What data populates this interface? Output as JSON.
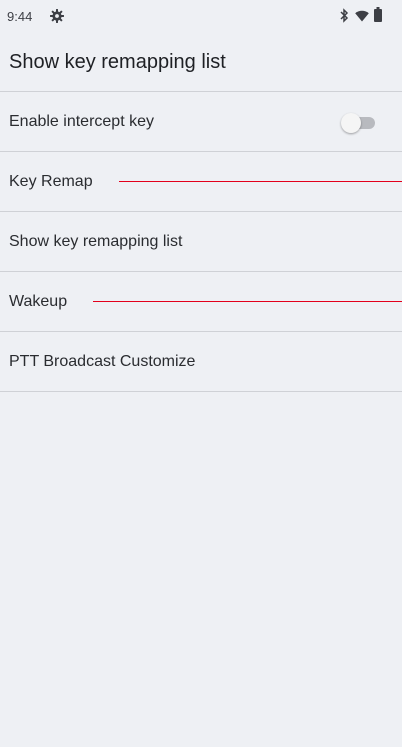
{
  "status_bar": {
    "time": "9:44",
    "icons": [
      "gear-icon",
      "bluetooth-icon",
      "wifi-icon",
      "battery-icon"
    ]
  },
  "app_bar": {
    "title": "Show key remapping list"
  },
  "settings": {
    "items": [
      {
        "label": "Enable intercept key",
        "toggle": {
          "on": false
        }
      },
      {
        "label": "Key Remap"
      },
      {
        "label": "Show key remapping list"
      },
      {
        "label": "Wakeup"
      },
      {
        "label": "PTT Broadcast Customize"
      }
    ]
  },
  "colors": {
    "background": "#eef0f4",
    "annotation_line": "#e3001b",
    "divider": "#cfd1d6",
    "text_primary": "#1e2024"
  }
}
